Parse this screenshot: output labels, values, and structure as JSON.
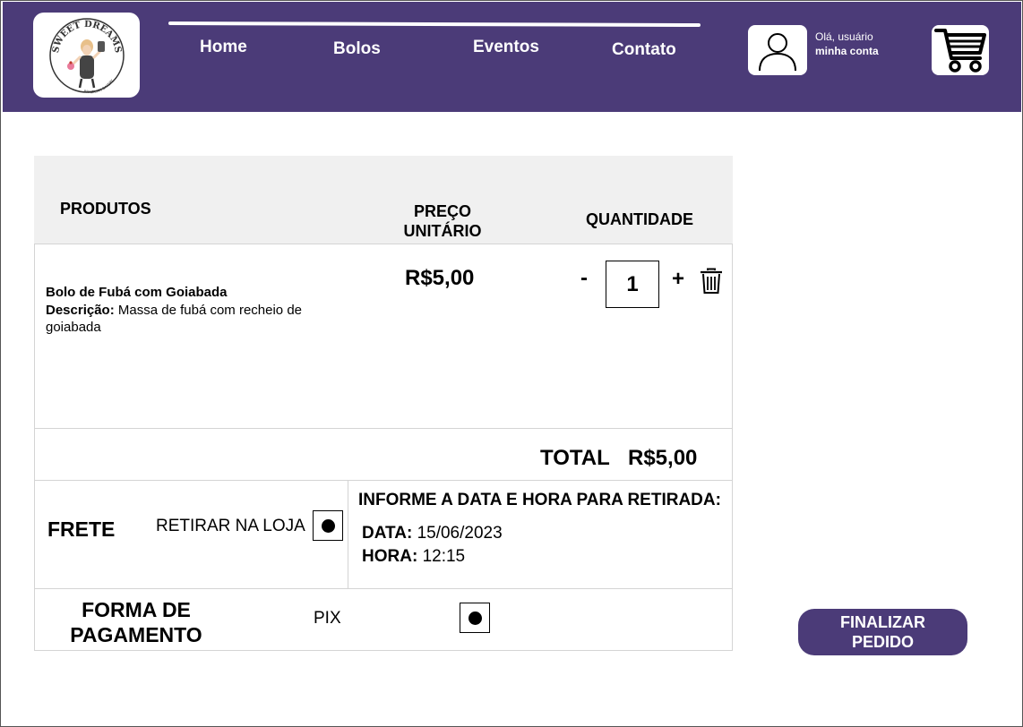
{
  "brand": {
    "logo_text": "SWEET DREAMS",
    "logo_subtext": "BRAZILIAN BAKERY"
  },
  "nav": {
    "home": "Home",
    "bolos": "Bolos",
    "eventos": "Eventos",
    "contato": "Contato"
  },
  "account": {
    "greeting": "Olá, usuário",
    "link": "minha conta",
    "icon": "user-icon"
  },
  "cart": {
    "icon": "shopping-cart-icon"
  },
  "table": {
    "headers": {
      "products": "PRODUTOS",
      "unit_price_1": "PREÇO",
      "unit_price_2": "UNITÁRIO",
      "quantity": "QUANTIDADE"
    },
    "item": {
      "name": "Bolo de Fubá com Goiabada",
      "desc_label": "Descrição:",
      "desc_text": "Massa de fubá com recheio de goiabada",
      "price": "R$5,00",
      "qty_minus": "-",
      "qty": "1",
      "qty_plus": "+"
    },
    "total_label": "TOTAL",
    "total_value": "R$5,00"
  },
  "shipping": {
    "label": "FRETE",
    "option": "RETIRAR NA LOJA",
    "pickup_title": "INFORME A DATA E HORA PARA RETIRADA:",
    "date_label": "DATA:",
    "date_value": "15/06/2023",
    "time_label": "HORA:",
    "time_value": "12:15"
  },
  "payment": {
    "label_1": "FORMA DE",
    "label_2": "PAGAMENTO",
    "option": "PIX"
  },
  "finalize": {
    "line_1": "FINALIZAR",
    "line_2": "PEDIDO"
  },
  "colors": {
    "brand": "#4b3b78",
    "header_bg": "#f0f0f0",
    "border": "#d4d4d4"
  }
}
